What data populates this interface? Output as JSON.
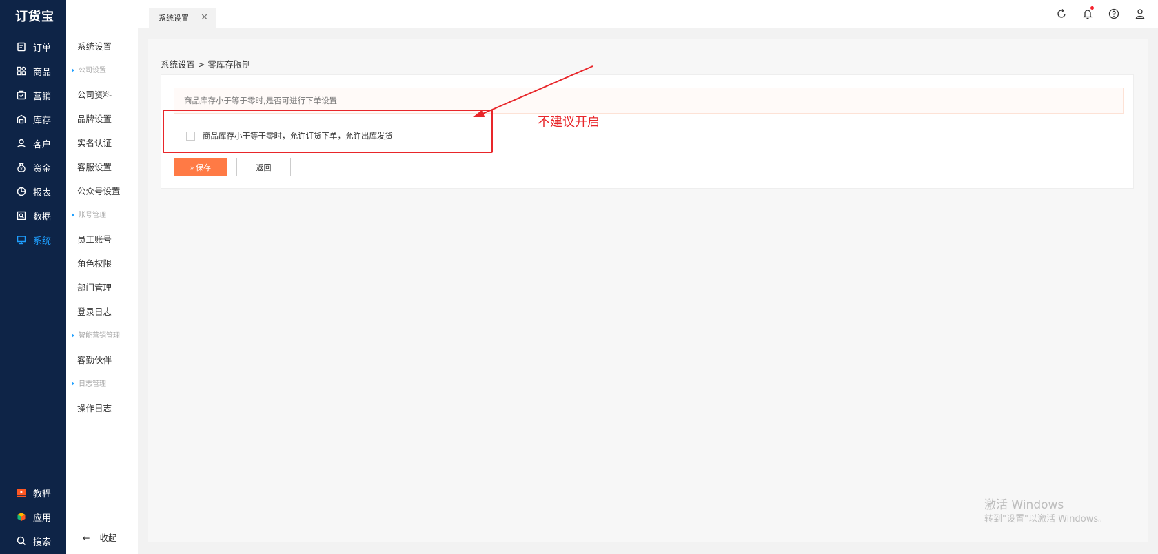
{
  "app": {
    "logo": "订货宝"
  },
  "nav": {
    "items": [
      {
        "label": "订单",
        "icon": "order-icon"
      },
      {
        "label": "商品",
        "icon": "goods-icon"
      },
      {
        "label": "营销",
        "icon": "marketing-icon"
      },
      {
        "label": "库存",
        "icon": "warehouse-icon"
      },
      {
        "label": "客户",
        "icon": "customer-icon"
      },
      {
        "label": "资金",
        "icon": "money-bag-icon"
      },
      {
        "label": "报表",
        "icon": "report-icon"
      },
      {
        "label": "数据",
        "icon": "data-icon"
      },
      {
        "label": "系统",
        "icon": "monitor-icon"
      }
    ],
    "bottom": [
      {
        "label": "教程",
        "icon": "tutorial-icon"
      },
      {
        "label": "应用",
        "icon": "apps-icon"
      },
      {
        "label": "搜索",
        "icon": "search-icon"
      }
    ]
  },
  "subnav": {
    "top": "系统设置",
    "groups": {
      "company": "公司设置",
      "account": "账号管理",
      "smart": "智能营销管理",
      "log": "日志管理"
    },
    "items": {
      "company_profile": "公司资料",
      "brand": "品牌设置",
      "realname": "实名认证",
      "service": "客服设置",
      "official": "公众号设置",
      "staff": "员工账号",
      "role": "角色权限",
      "dept": "部门管理",
      "login_log": "登录日志",
      "partner": "客勤伙伴",
      "op_log": "操作日志"
    },
    "collapse": "收起"
  },
  "tabs": {
    "active": "系统设置"
  },
  "page": {
    "breadcrumb": "系统设置 > 零库存限制",
    "notice": "商品库存小于等于零时,是否可进行下单设置",
    "option": "商品库存小于等于零时，允许订货下单，允许出库发货",
    "save": "保存",
    "back": "返回"
  },
  "annotation": {
    "text": "不建议开启",
    "color": "#e8262a"
  },
  "watermark": {
    "line1": "激活 Windows",
    "line2": "转到\"设置\"以激活 Windows。"
  },
  "colors": {
    "nav_bg": "#0e2447",
    "accent": "#1e9fff",
    "save": "#ff7a45"
  }
}
